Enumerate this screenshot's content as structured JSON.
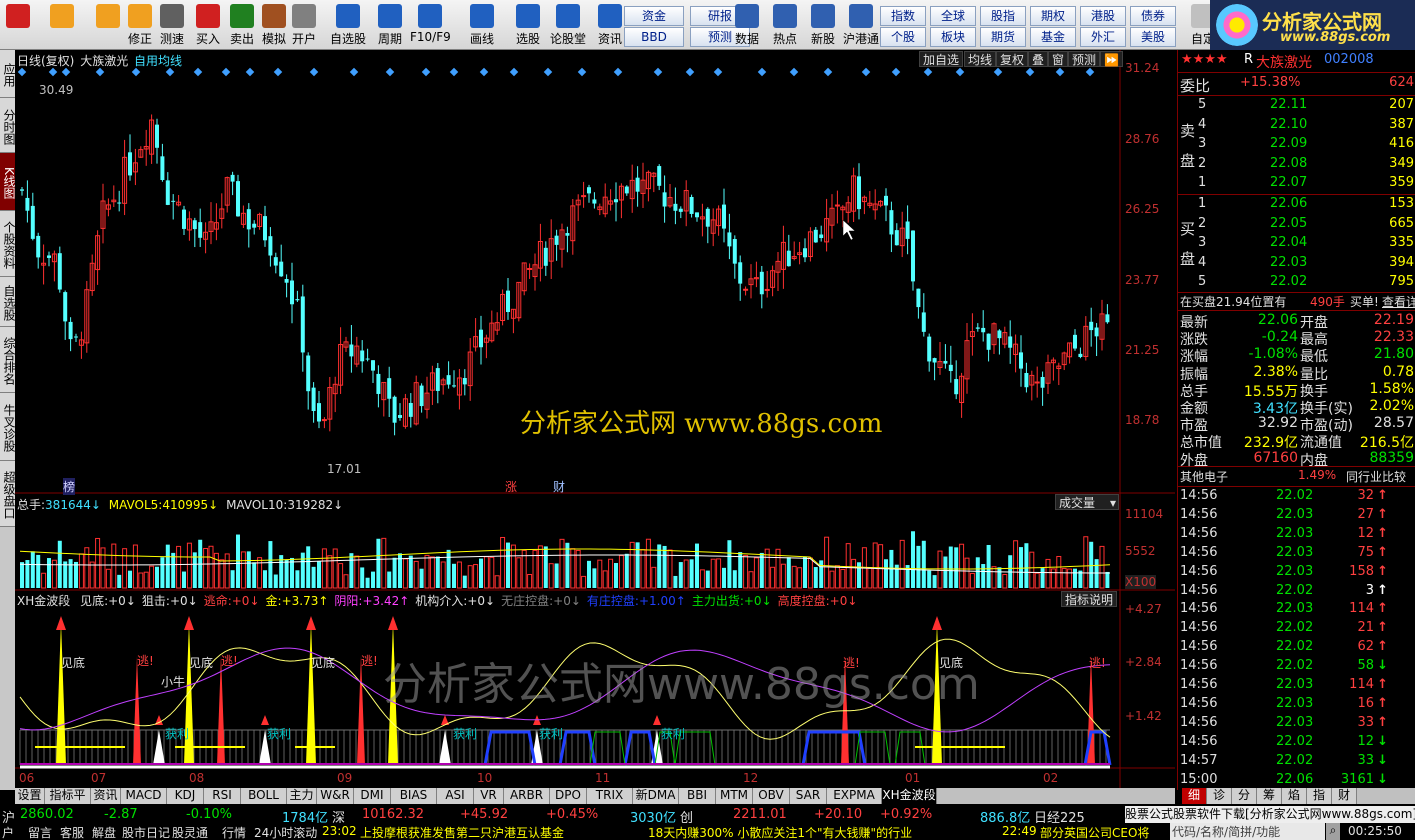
{
  "toolbar": {
    "big_buttons": [
      {
        "label": "",
        "icon": "grid-icon",
        "color": "#d02020"
      },
      {
        "label": "",
        "icon": "back-arrow-icon",
        "color": "#f0a020"
      },
      {
        "label": "",
        "icon": "up-down-icon",
        "color": "#f0a020"
      },
      {
        "label": "修正",
        "icon": "clock-icon",
        "color": "#f0a020"
      },
      {
        "label": "测速",
        "icon": "timer-icon",
        "color": "#606060"
      },
      {
        "label": "买入",
        "icon": "buy-icon",
        "color": "#d02020"
      },
      {
        "label": "卖出",
        "icon": "sell-icon",
        "color": "#208020"
      },
      {
        "label": "模拟",
        "icon": "hammer-icon",
        "color": "#a05020"
      },
      {
        "label": "开户",
        "icon": "lock-icon",
        "color": "#808080"
      },
      {
        "label": "自选股",
        "icon": "star-icon",
        "color": "#2060c0"
      },
      {
        "label": "周期",
        "icon": "period-icon",
        "color": "#2060c0"
      },
      {
        "label": "F10/F9",
        "icon": "f10-icon",
        "color": "#2060c0"
      },
      {
        "label": "画线",
        "icon": "draw-icon",
        "color": "#2060c0"
      },
      {
        "label": "选股",
        "icon": "select-icon",
        "color": "#2060c0"
      },
      {
        "label": "论股堂",
        "icon": "forum-icon",
        "color": "#2060c0"
      },
      {
        "label": "资讯",
        "icon": "news-icon",
        "color": "#2060c0"
      }
    ],
    "mid_buttons": [
      {
        "label": "资金"
      },
      {
        "label": "研报"
      },
      {
        "label": "BBD"
      },
      {
        "label": "预测"
      }
    ],
    "icon_buttons": [
      {
        "label": "数据",
        "icon": "pe-icon"
      },
      {
        "label": "热点",
        "icon": "hot-icon"
      },
      {
        "label": "新股",
        "icon": "newstock-icon"
      },
      {
        "label": "沪港通",
        "icon": "hk-icon"
      }
    ],
    "right_buttons": [
      {
        "label": "指数"
      },
      {
        "label": "全球"
      },
      {
        "label": "股指"
      },
      {
        "label": "期权"
      },
      {
        "label": "港股"
      },
      {
        "label": "债券"
      },
      {
        "label": "个股"
      },
      {
        "label": "板块"
      },
      {
        "label": "期货"
      },
      {
        "label": "基金"
      },
      {
        "label": "外汇"
      },
      {
        "label": "美股"
      }
    ],
    "extra": "自定",
    "logo_title": "分析家公式网",
    "logo_url": "www.88gs.com"
  },
  "left_tabs": [
    {
      "label": "应用",
      "active": false
    },
    {
      "label": "分时图",
      "active": false
    },
    {
      "label": "K线图",
      "active": true
    },
    {
      "label": "个股资料",
      "active": false
    },
    {
      "label": "自选股",
      "active": false
    },
    {
      "label": "综合排名",
      "active": false
    },
    {
      "label": "牛叉诊股",
      "active": false
    },
    {
      "label": "超级盘口",
      "active": false
    }
  ],
  "chart_header": {
    "period": "日线(复权)",
    "stock": "大族激光",
    "ma": "自用均线",
    "buttons": [
      "加自选",
      "均线",
      "复权",
      "叠",
      "窗",
      "预测",
      "⏩"
    ]
  },
  "price_axis": [
    "31.24",
    "28.76",
    "26.25",
    "23.77",
    "21.25",
    "18.78"
  ],
  "price_marks": {
    "high": "30.49",
    "low": "17.01"
  },
  "event_marks": [
    "榜",
    "涨",
    "财"
  ],
  "watermark": "分析家公式网 www.88gs.com",
  "watermark2": "分析家公式网www.88gs.com",
  "volume": {
    "total_label": "总手:",
    "total": "381644",
    "mavol5_label": "MAVOL5:",
    "mavol5": "410995",
    "mavol10_label": "MAVOL10:",
    "mavol10": "319282",
    "dropdown": "成交量",
    "axis": [
      "11104",
      "5552",
      "X100"
    ]
  },
  "indicator": {
    "name": "XH金波段",
    "items": [
      {
        "label": "见底:",
        "value": "+0",
        "color": "#e0e0e0"
      },
      {
        "label": "狙击:",
        "value": "+0",
        "color": "#e0e0e0"
      },
      {
        "label": "逃命:",
        "value": "+0",
        "color": "#ff4040"
      },
      {
        "label": "金:",
        "value": "+3.73",
        "color": "#ffff00"
      },
      {
        "label": "阴阳:",
        "value": "+3.42",
        "color": "#ff40ff"
      },
      {
        "label": "机构介入:",
        "value": "+0",
        "color": "#e0e0e0"
      },
      {
        "label": "无庄控盘:",
        "value": "+0",
        "color": "#808080"
      },
      {
        "label": "有庄控盘:",
        "value": "+1.00",
        "color": "#2040ff"
      },
      {
        "label": "主力出货:",
        "value": "+0",
        "color": "#00e000"
      },
      {
        "label": "高度控盘:",
        "value": "+0",
        "color": "#ff4040"
      }
    ],
    "help": "指标说明",
    "axis": [
      "+4.27",
      "+2.84",
      "+1.42"
    ],
    "signals": {
      "bottom": "见底",
      "escape": "逃!",
      "bull": "小牛",
      "profit": "获利"
    }
  },
  "months": [
    "06",
    "07",
    "08",
    "09",
    "10",
    "11",
    "12",
    "01",
    "02"
  ],
  "bottom_tabs": [
    "设置",
    "指标平台",
    "资讯",
    "MACD",
    "KDJ",
    "RSI",
    "BOLL",
    "主力",
    "W&R",
    "DMI",
    "BIAS",
    "ASI",
    "VR",
    "ARBR",
    "DPO",
    "TRIX",
    "新DMA",
    "BBI",
    "MTM",
    "OBV",
    "SAR",
    "EXPMA",
    "XH金波段"
  ],
  "bottom_tabs_active": "XH金波段",
  "right_panel": {
    "header": {
      "stars": "★★★★",
      "code_prefix": "R",
      "name": "大族激光",
      "code": "002008"
    },
    "weibi": {
      "label": "委比",
      "pct": "+15.38%",
      "num": "624"
    },
    "sell_label": "卖盘",
    "buy_label": "买盘",
    "sell": [
      {
        "n": "5",
        "price": "22.11",
        "vol": "207"
      },
      {
        "n": "4",
        "price": "22.10",
        "vol": "387"
      },
      {
        "n": "3",
        "price": "22.09",
        "vol": "416"
      },
      {
        "n": "2",
        "price": "22.08",
        "vol": "349"
      },
      {
        "n": "1",
        "price": "22.07",
        "vol": "359"
      }
    ],
    "buy": [
      {
        "n": "1",
        "price": "22.06",
        "vol": "153"
      },
      {
        "n": "2",
        "price": "22.05",
        "vol": "665"
      },
      {
        "n": "3",
        "price": "22.04",
        "vol": "335"
      },
      {
        "n": "4",
        "price": "22.03",
        "vol": "394"
      },
      {
        "n": "5",
        "price": "22.02",
        "vol": "795"
      }
    ],
    "notice": {
      "text": "在买盘21.94位置有",
      "qty": "490手",
      "act": "买单!",
      "link": "查看详细"
    },
    "stats": [
      {
        "l1": "最新",
        "v1": "22.06",
        "c1": "#00e000",
        "l2": "开盘",
        "v2": "22.19",
        "c2": "#ff4040"
      },
      {
        "l1": "涨跌",
        "v1": "-0.24",
        "c1": "#00e000",
        "l2": "最高",
        "v2": "22.33",
        "c2": "#ff4040"
      },
      {
        "l1": "涨幅",
        "v1": "-1.08%",
        "c1": "#00e000",
        "l2": "最低",
        "v2": "21.80",
        "c2": "#00e000"
      },
      {
        "l1": "振幅",
        "v1": "2.38%",
        "c1": "#ffff00",
        "l2": "量比",
        "v2": "0.78",
        "c2": "#ffff00"
      },
      {
        "l1": "总手",
        "v1": "15.55万",
        "c1": "#ffff00",
        "l2": "换手",
        "v2": "1.58%",
        "c2": "#ffff00"
      },
      {
        "l1": "金额",
        "v1": "3.43亿",
        "c1": "#40e0ff",
        "l2": "换手(实)",
        "v2": "2.02%",
        "c2": "#ffff00"
      },
      {
        "l1": "市盈",
        "v1": "32.92",
        "c1": "#e0e0e0",
        "l2": "市盈(动)",
        "v2": "28.57",
        "c2": "#e0e0e0"
      },
      {
        "l1": "总市值",
        "v1": "232.9亿",
        "c1": "#ffff00",
        "l2": "流通值",
        "v2": "216.5亿",
        "c2": "#ffff00"
      },
      {
        "l1": "外盘",
        "v1": "67160",
        "c1": "#ff4040",
        "l2": "内盘",
        "v2": "88359",
        "c2": "#00e000"
      }
    ],
    "sector": {
      "name": "其他电子",
      "pct": "1.49%",
      "link": "同行业比较"
    },
    "ticks": [
      {
        "t": "14:56",
        "p": "22.02",
        "pc": "#00e000",
        "v": "32",
        "vc": "#ff4040",
        "d": "up"
      },
      {
        "t": "14:56",
        "p": "22.03",
        "pc": "#00e000",
        "v": "27",
        "vc": "#ff4040",
        "d": "up"
      },
      {
        "t": "14:56",
        "p": "22.03",
        "pc": "#00e000",
        "v": "12",
        "vc": "#ff4040",
        "d": "up"
      },
      {
        "t": "14:56",
        "p": "22.03",
        "pc": "#00e000",
        "v": "75",
        "vc": "#ff4040",
        "d": "up"
      },
      {
        "t": "14:56",
        "p": "22.03",
        "pc": "#00e000",
        "v": "158",
        "vc": "#ff4040",
        "d": "up"
      },
      {
        "t": "14:56",
        "p": "22.02",
        "pc": "#00e000",
        "v": "3",
        "vc": "#ffffff",
        "d": "white"
      },
      {
        "t": "14:56",
        "p": "22.03",
        "pc": "#00e000",
        "v": "114",
        "vc": "#ff4040",
        "d": "up"
      },
      {
        "t": "14:56",
        "p": "22.02",
        "pc": "#00e000",
        "v": "21",
        "vc": "#ff4040",
        "d": "up"
      },
      {
        "t": "14:56",
        "p": "22.02",
        "pc": "#00e000",
        "v": "62",
        "vc": "#ff4040",
        "d": "up"
      },
      {
        "t": "14:56",
        "p": "22.02",
        "pc": "#00e000",
        "v": "58",
        "vc": "#00e000",
        "d": "down"
      },
      {
        "t": "14:56",
        "p": "22.03",
        "pc": "#00e000",
        "v": "114",
        "vc": "#ff4040",
        "d": "up"
      },
      {
        "t": "14:56",
        "p": "22.03",
        "pc": "#00e000",
        "v": "16",
        "vc": "#ff4040",
        "d": "up"
      },
      {
        "t": "14:56",
        "p": "22.03",
        "pc": "#00e000",
        "v": "33",
        "vc": "#ff4040",
        "d": "up"
      },
      {
        "t": "14:56",
        "p": "22.02",
        "pc": "#00e000",
        "v": "12",
        "vc": "#00e000",
        "d": "down"
      },
      {
        "t": "14:57",
        "p": "22.02",
        "pc": "#00e000",
        "v": "33",
        "vc": "#00e000",
        "d": "down"
      },
      {
        "t": "15:00",
        "p": "22.06",
        "pc": "#00e000",
        "v": "3161",
        "vc": "#00e000",
        "d": "down"
      }
    ],
    "bottom_tabs": [
      "细",
      "诊",
      "分",
      "筹",
      "焰",
      "指",
      "财"
    ]
  },
  "status1": {
    "hu_label": "沪",
    "hu_val": "2860.02",
    "hu_chg": "-2.87",
    "hu_pct": "-0.10%",
    "hu_amt": "1784亿",
    "shen_label": "深",
    "shen_val": "10162.32",
    "shen_chg": "+45.92",
    "shen_pct": "+0.45%",
    "shen_amt": "3030亿",
    "chuang_label": "创",
    "chuang_val": "2211.01",
    "chuang_chg": "+20.10",
    "chuang_pct": "+0.92%",
    "chuang_amt": "886.8亿",
    "rijing": "日经225"
  },
  "ad_text": "股票公式股票软件下载[分析家公式网www.88gs.com]",
  "status2": {
    "items": [
      "户",
      "留言",
      "客服",
      "解盘",
      "股市日记",
      "股灵通",
      "行情",
      "24小时滚动"
    ],
    "news1_time": "23:02",
    "news1": "上投摩根获准发售第二只沪港互认基金",
    "news2": "18天内赚300% 小散应关注1个\"有大钱赚\"的行业",
    "news3_time": "22:49",
    "news3": "部分英国公司CEO将",
    "search_hint": "代码/名称/简拼/功能",
    "clock": "00:25:50"
  }
}
